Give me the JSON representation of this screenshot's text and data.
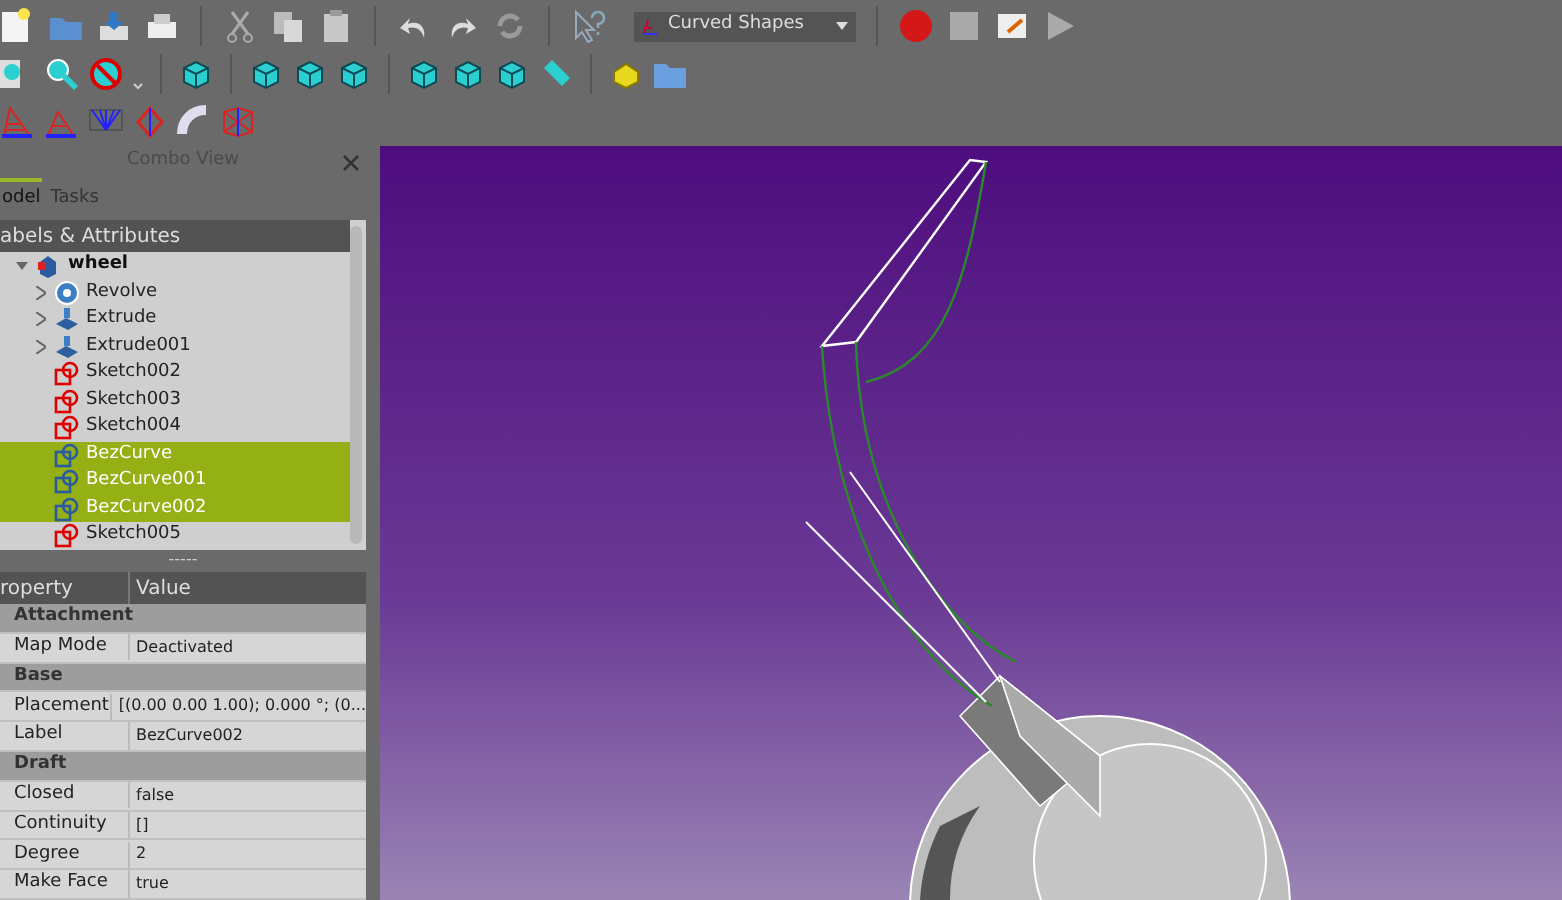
{
  "toolbar": {
    "workbench": "Curved Shapes"
  },
  "combo_view": {
    "title": "Combo View",
    "tabs": [
      {
        "label": "odel",
        "selected": true
      },
      {
        "label": "Tasks",
        "selected": false
      }
    ],
    "tree": {
      "header": "abels & Attributes",
      "root": {
        "label": "wheel",
        "expanded": true,
        "children": [
          {
            "label": "Revolve",
            "kind": "revolve",
            "arrow": true,
            "selected": false
          },
          {
            "label": "Extrude",
            "kind": "extrude",
            "arrow": true,
            "selected": false
          },
          {
            "label": "Extrude001",
            "kind": "extrude",
            "arrow": true,
            "selected": false
          },
          {
            "label": "Sketch002",
            "kind": "sketch",
            "arrow": false,
            "selected": false
          },
          {
            "label": "Sketch003",
            "kind": "sketch",
            "arrow": false,
            "selected": false
          },
          {
            "label": "Sketch004",
            "kind": "sketch",
            "arrow": false,
            "selected": false
          },
          {
            "label": "BezCurve",
            "kind": "curve",
            "arrow": false,
            "selected": true
          },
          {
            "label": "BezCurve001",
            "kind": "curve",
            "arrow": false,
            "selected": true
          },
          {
            "label": "BezCurve002",
            "kind": "curve",
            "arrow": false,
            "selected": true
          },
          {
            "label": "Sketch005",
            "kind": "sketch",
            "arrow": false,
            "selected": false
          }
        ]
      }
    },
    "splitter": "-----",
    "properties": {
      "columns": [
        "roperty",
        "Value"
      ],
      "rows": [
        {
          "kind": "group",
          "name": "Attachment"
        },
        {
          "kind": "prop",
          "name": "Map Mode",
          "value": "Deactivated"
        },
        {
          "kind": "group",
          "name": "Base"
        },
        {
          "kind": "prop",
          "name": "Placement",
          "value": "[(0.00 0.00 1.00); 0.000 °; (0..."
        },
        {
          "kind": "prop",
          "name": "Label",
          "value": "BezCurve002"
        },
        {
          "kind": "group",
          "name": "Draft"
        },
        {
          "kind": "prop",
          "name": "Closed",
          "value": "false"
        },
        {
          "kind": "prop",
          "name": "Continuity",
          "value": "[]"
        },
        {
          "kind": "prop",
          "name": "Degree",
          "value": "2"
        },
        {
          "kind": "prop",
          "name": "Make Face",
          "value": "true"
        }
      ]
    }
  }
}
